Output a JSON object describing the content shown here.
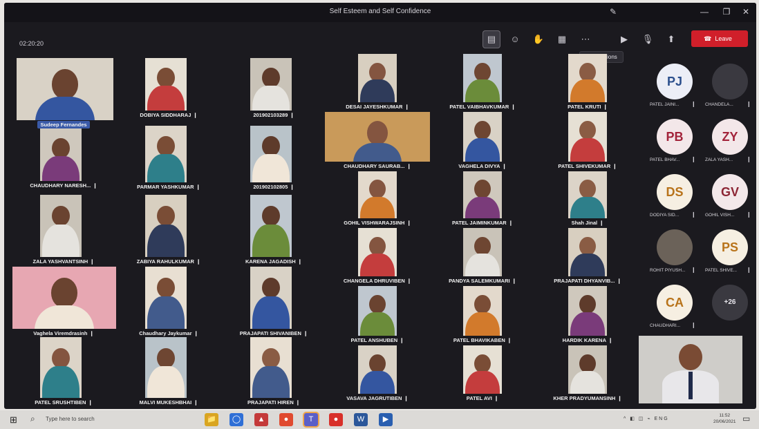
{
  "window": {
    "title": "Self Esteem and Self Confidence",
    "minimize": "—",
    "maximize": "❐",
    "close": "✕",
    "pen": "✎"
  },
  "toolbar": {
    "timer": "02:20:20",
    "leave_label": "Leave",
    "leave_icon": "☎",
    "tooltip": "More actions",
    "icons": [
      "▤",
      "☺",
      "✋",
      "▦",
      "⋯",
      "▶",
      "🎙",
      "⬆"
    ]
  },
  "participants": [
    {
      "name": "Sudeep Fernandes",
      "boxed": true
    },
    {
      "name": "DOBIYA SIDDHARAJ"
    },
    {
      "name": "201902103289"
    },
    {
      "name": "DESAI JAYESHKUMAR"
    },
    {
      "name": "PATEL VAIBHAVKUMAR"
    },
    {
      "name": "PATEL KRUTI"
    },
    {
      "name": "CHAUDHARY NARESH..."
    },
    {
      "name": "PARMAR YASHKUMAR"
    },
    {
      "name": "201902102805"
    },
    {
      "name": "CHAUDHARY SAURAB..."
    },
    {
      "name": "VAGHELA DIVYA"
    },
    {
      "name": "PATEL SHIVEKUMAR"
    },
    {
      "name": "ZALA YASHVANTSINH"
    },
    {
      "name": "ZABIYA RAHULKUMAR"
    },
    {
      "name": "KARENA JAGADISH"
    },
    {
      "name": "GOHIL VISHWARAJSINH"
    },
    {
      "name": "PATEL JAIMINKUMAR"
    },
    {
      "name": "Shah Jinal"
    },
    {
      "name": "Vaghela Viremdrasinh"
    },
    {
      "name": "Chaudhary Jaykumar"
    },
    {
      "name": "PRAJAPATI SHIVANIBEN"
    },
    {
      "name": "CHANGELA DHRUVIBEN"
    },
    {
      "name": "PANDYA SALEMKUMARI"
    },
    {
      "name": "PRAJAPATI DHYANVIB..."
    },
    {
      "name": "PATEL ANSHUBEN"
    },
    {
      "name": "PATEL BHAVIKABEN"
    },
    {
      "name": "HARDIK KARENA"
    },
    {
      "name": "PATEL SRUSHTIBEN"
    },
    {
      "name": "MALVI MUKESHBHAI"
    },
    {
      "name": "PRAJAPATI HIREN"
    },
    {
      "name": "VASAVA JAGRUTIBEN"
    },
    {
      "name": "PATEL AVI"
    },
    {
      "name": "KHER PRADYUMANSINH"
    }
  ],
  "roster": [
    {
      "initials": "PJ",
      "name": "PATEL JAINI...",
      "color": "#2b4f8c",
      "bg": "#eceef6"
    },
    {
      "initials": "",
      "name": "CHANDELA...",
      "color": "#5b5a5f",
      "bg": "#3a3940"
    },
    {
      "initials": "PB",
      "name": "PATEL BHAV...",
      "color": "#a2233a",
      "bg": "#f3e7e9"
    },
    {
      "initials": "ZY",
      "name": "ZALA YASH...",
      "color": "#a2233a",
      "bg": "#f3e7e9"
    },
    {
      "initials": "DS",
      "name": "DODIYA SID...",
      "color": "#b8731a",
      "bg": "#f6efe2"
    },
    {
      "initials": "GV",
      "name": "GOHIL VISH...",
      "color": "#8c2535",
      "bg": "#f3e8ea"
    },
    {
      "initials": "",
      "name": "ROHIT PIYUSH...",
      "color": "#5b5a5f",
      "bg": "#6b6259"
    },
    {
      "initials": "PS",
      "name": "PATEL SHIVE...",
      "color": "#b8731a",
      "bg": "#f6efe2"
    },
    {
      "initials": "CA",
      "name": "CHAUDHARI...",
      "color": "#b8731a",
      "bg": "#f6efe2"
    },
    {
      "initials": "+26",
      "name": "",
      "color": "#e8e6ec",
      "bg": "#3a3940"
    }
  ],
  "taskbar": {
    "start_icon": "⊞",
    "search_icon": "⌕",
    "search_placeholder": "Type here to search",
    "apps": [
      "📁",
      "◯",
      "▲",
      "●",
      "T",
      "●",
      "W",
      "▶"
    ],
    "tray": "^ ◧ ◫ ⌁ ENG",
    "time": "11:52",
    "date": "20/06/2021",
    "notification_icon": "▭"
  },
  "colors": {
    "background": "#1b1a1f",
    "leave": "#d01f2a",
    "accent": "#3a5aa8"
  }
}
